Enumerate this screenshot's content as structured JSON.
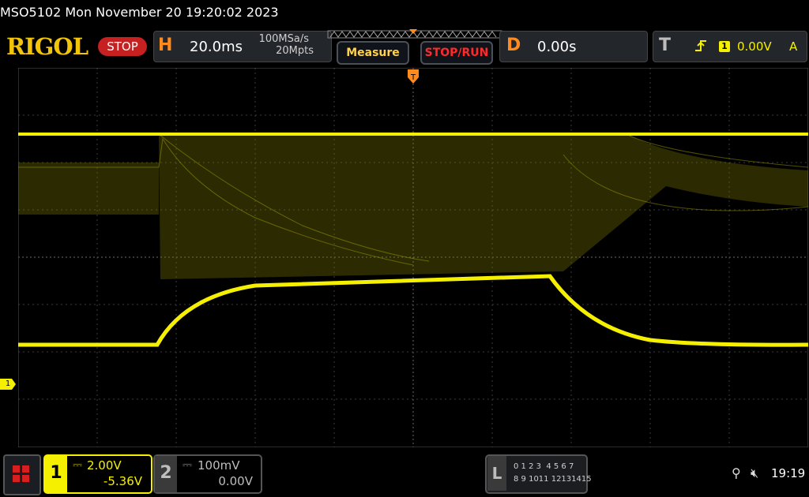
{
  "title": "MSO5102  Mon November 20 19:20:02 2023",
  "logo": "RIGOL",
  "run_state": "STOP",
  "horizontal": {
    "letter": "H",
    "timebase": "20.0ms",
    "sample_rate": "100MSa/s",
    "memory": "20Mpts"
  },
  "buttons": {
    "measure": "Measure",
    "stop_run": "STOP/RUN"
  },
  "delay": {
    "letter": "D",
    "value": "0.00s"
  },
  "trigger": {
    "letter": "T",
    "channel": "1",
    "level": "0.00V",
    "mode": "A"
  },
  "channel1": {
    "number": "1",
    "scale": "2.00V",
    "offset": "-5.36V",
    "marker": "1"
  },
  "channel2": {
    "number": "2",
    "scale": "100mV",
    "offset": "0.00V"
  },
  "logic": {
    "letter": "L",
    "row1": "0 1 2 3  4 5 6 7",
    "row2": "8 9 1011 12131415"
  },
  "status": {
    "time": "19:19"
  },
  "colors": {
    "ch1": "#f5f000",
    "accent": "#ff8a1d",
    "stop": "#c62020"
  }
}
